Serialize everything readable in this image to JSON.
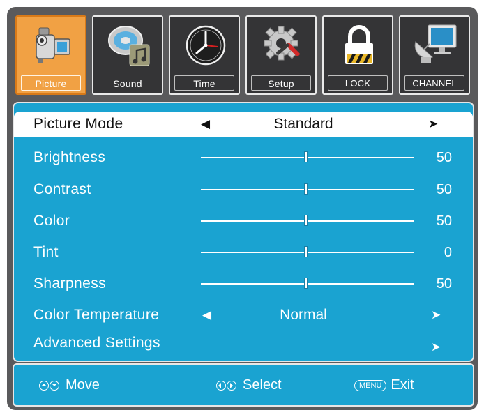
{
  "tabs": [
    {
      "label": "Picture",
      "icon": "camcorder-icon",
      "active": true
    },
    {
      "label": "Sound",
      "icon": "music-note-icon",
      "active": false
    },
    {
      "label": "Time",
      "icon": "clock-icon",
      "active": false
    },
    {
      "label": "Setup",
      "icon": "gear-wrench-icon",
      "active": false
    },
    {
      "label": "LOCK",
      "icon": "padlock-icon",
      "active": false
    },
    {
      "label": "CHANNEL",
      "icon": "satellite-dish-icon",
      "active": false
    }
  ],
  "menu": {
    "picture_mode": {
      "label": "Picture Mode",
      "value": "Standard"
    },
    "brightness": {
      "label": "Brightness",
      "value": "50",
      "level": 0.5
    },
    "contrast": {
      "label": "Contrast",
      "value": "50",
      "level": 0.5
    },
    "color": {
      "label": "Color",
      "value": "50",
      "level": 0.5
    },
    "tint": {
      "label": "Tint",
      "value": "0",
      "level": 0.5
    },
    "sharpness": {
      "label": "Sharpness",
      "value": "50",
      "level": 0.5
    },
    "color_temperature": {
      "label": "Color Temperature",
      "value": "Normal"
    },
    "advanced": {
      "label": "Advanced Settings"
    }
  },
  "footer": {
    "move": "Move",
    "select": "Select",
    "menu_key": "MENU",
    "exit": "Exit"
  },
  "colors": {
    "panel": "#1aa3d1",
    "frame": "#5a5a5c",
    "active_tab": "#f1a144",
    "tab": "#343436"
  }
}
